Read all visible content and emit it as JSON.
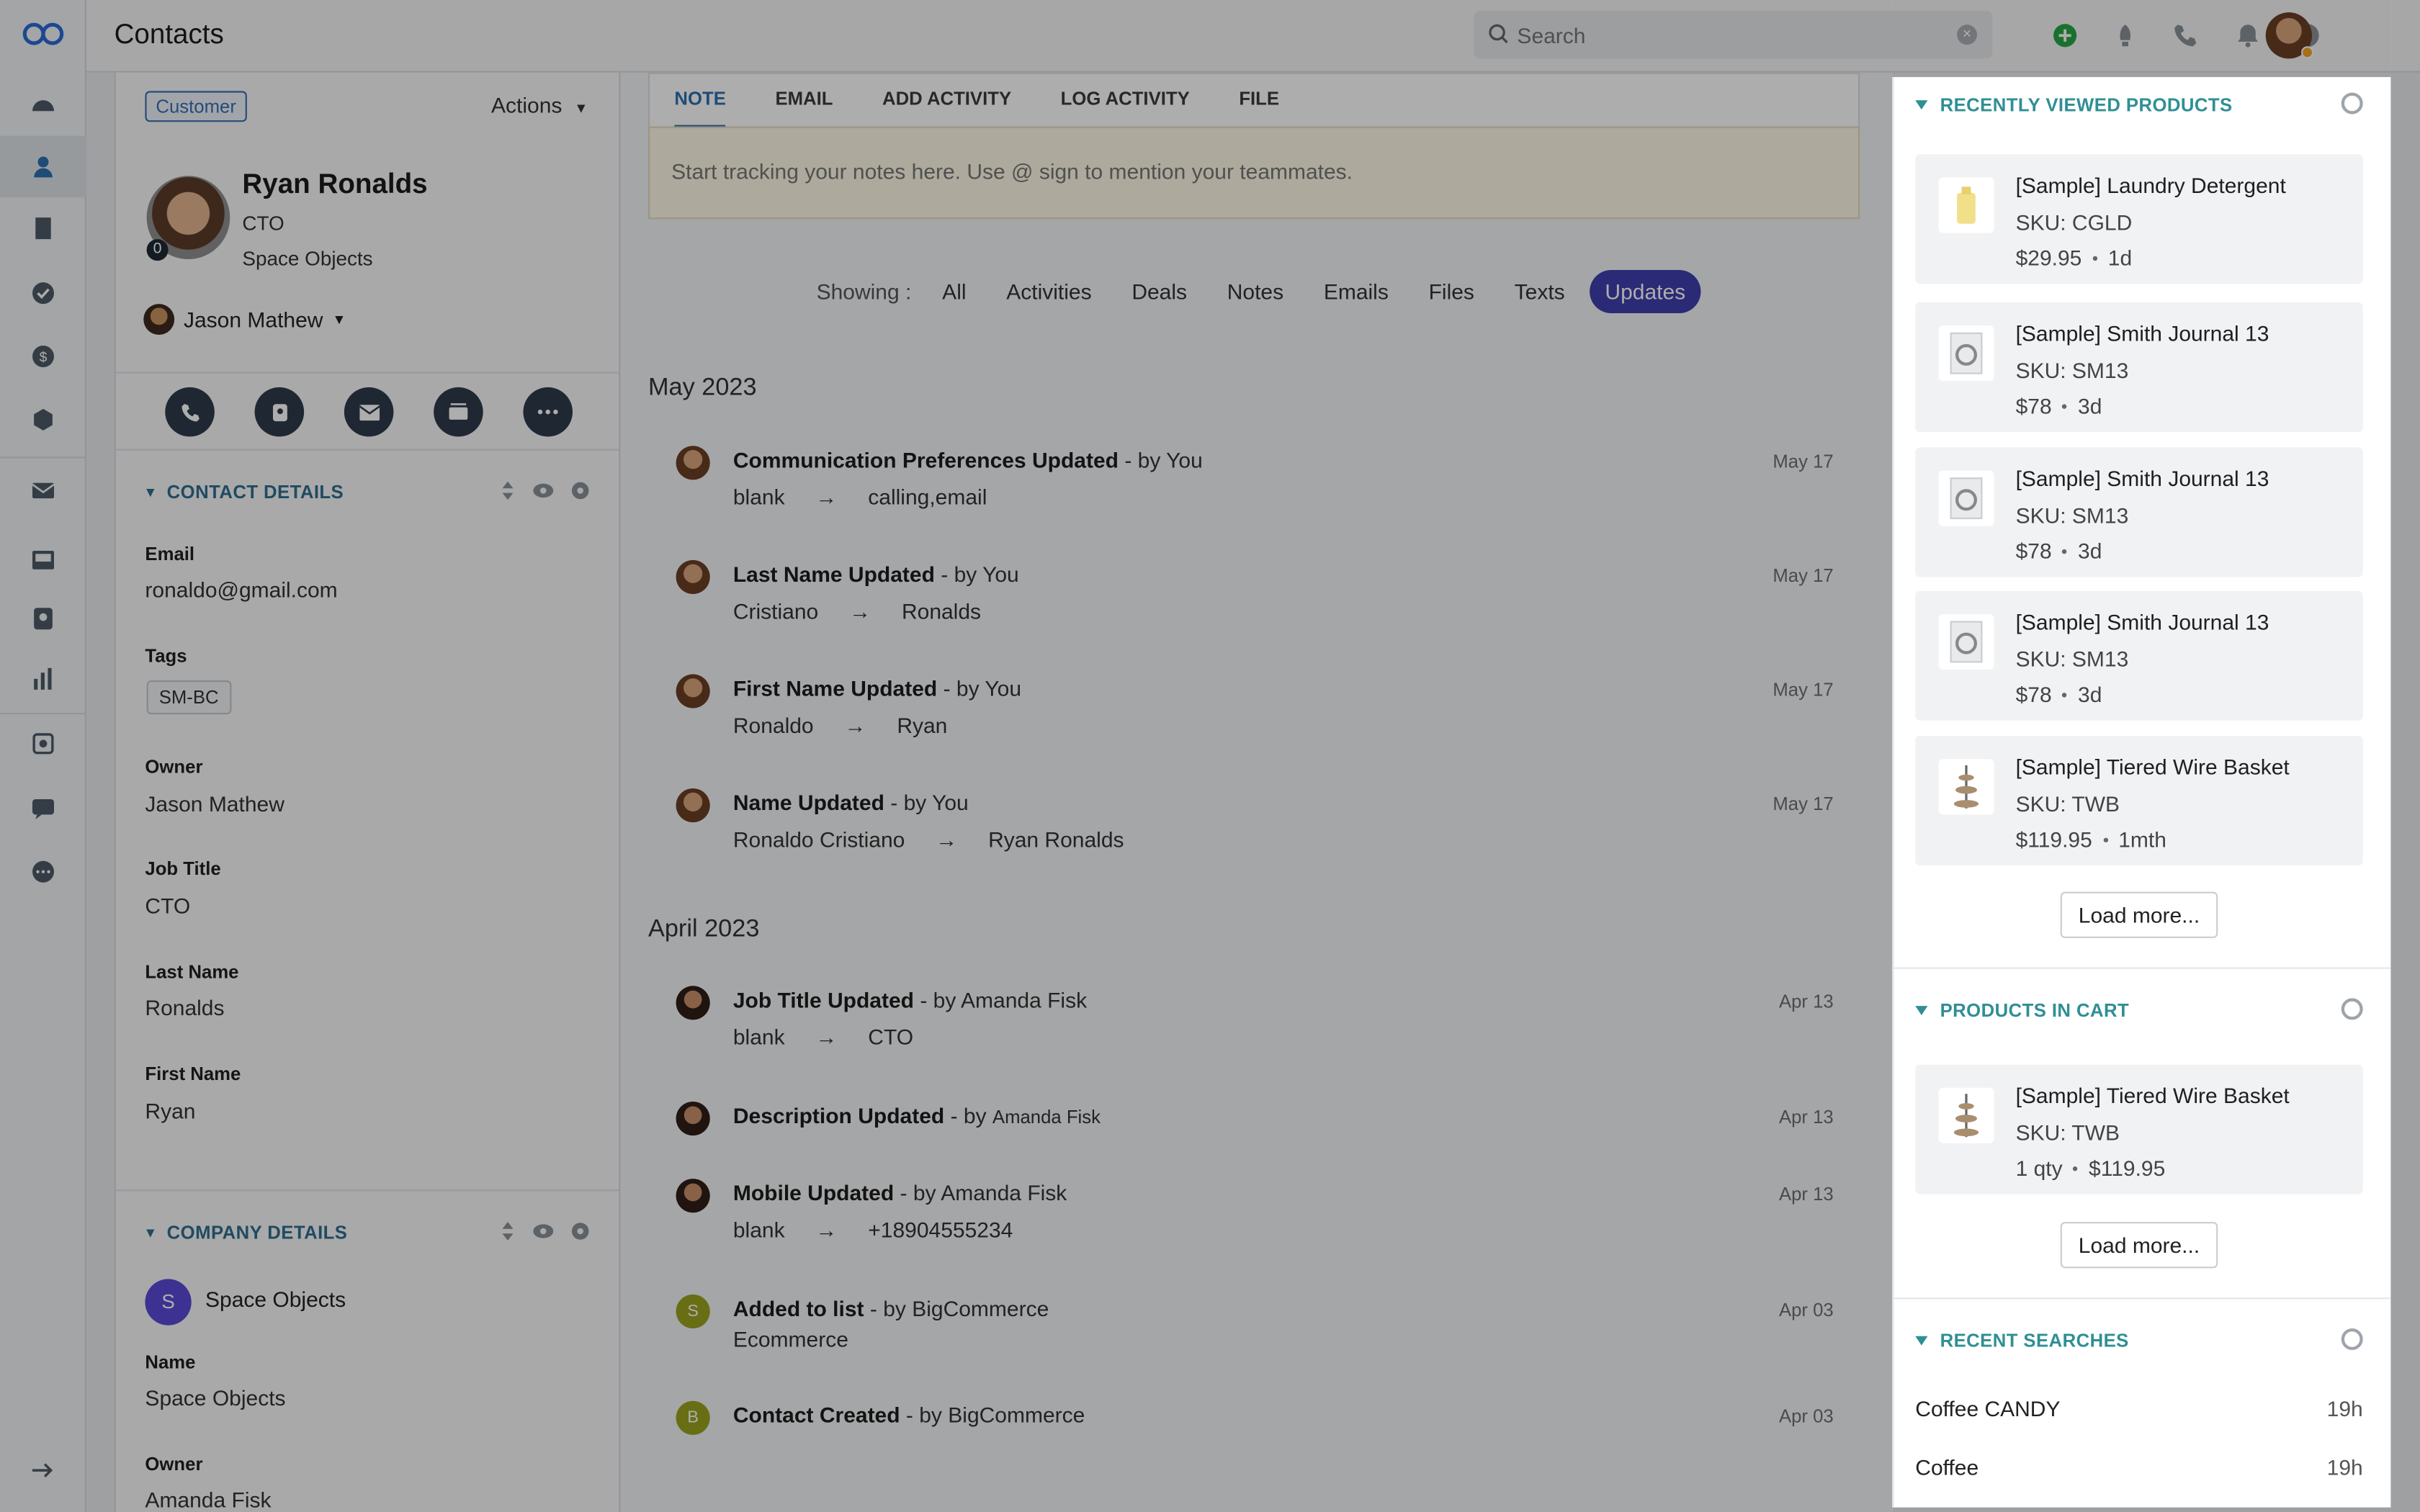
{
  "app": {
    "page_title": "Contacts"
  },
  "search": {
    "placeholder": "Search"
  },
  "profile": {
    "badge": "Customer",
    "actions_label": "Actions",
    "name": "Ryan Ronalds",
    "role": "CTO",
    "company": "Space Objects",
    "score": "0",
    "owner": "Jason Mathew"
  },
  "contact_details": {
    "header": "CONTACT DETAILS",
    "fields": [
      {
        "label": "Email",
        "value": "ronaldo@gmail.com"
      },
      {
        "label": "Tags",
        "value": "SM-BC"
      },
      {
        "label": "Owner",
        "value": "Jason Mathew"
      },
      {
        "label": "Job Title",
        "value": "CTO"
      },
      {
        "label": "Last Name",
        "value": "Ronalds"
      },
      {
        "label": "First Name",
        "value": "Ryan"
      }
    ]
  },
  "company_details": {
    "header": "COMPANY DETAILS",
    "avatar_letter": "S",
    "company_name": "Space Objects",
    "fields": [
      {
        "label": "Name",
        "value": "Space Objects"
      },
      {
        "label": "Owner",
        "value": "Amanda Fisk"
      }
    ]
  },
  "tabs": [
    "NOTE",
    "EMAIL",
    "ADD ACTIVITY",
    "LOG ACTIVITY",
    "FILE"
  ],
  "note_placeholder": "Start tracking your notes here. Use @ sign to mention your teammates.",
  "filters": {
    "label": "Showing :",
    "items": [
      "All",
      "Activities",
      "Deals",
      "Notes",
      "Emails",
      "Files",
      "Texts",
      "Updates"
    ],
    "active": "Updates"
  },
  "timeline": {
    "groups": [
      {
        "month": "May 2023",
        "events": [
          {
            "title": "Communication Preferences Updated",
            "by": "- by You",
            "from": "blank",
            "to": "calling,email",
            "date": "May 17"
          },
          {
            "title": "Last Name Updated",
            "by": "- by You",
            "from": "Cristiano",
            "to": "Ronalds",
            "date": "May 17"
          },
          {
            "title": "First Name Updated",
            "by": "- by You",
            "from": "Ronaldo",
            "to": "Ryan",
            "date": "May 17"
          },
          {
            "title": "Name Updated",
            "by": "- by You",
            "from": "Ronaldo Cristiano",
            "to": "Ryan Ronalds",
            "date": "May 17"
          }
        ]
      },
      {
        "month": "April 2023",
        "events": [
          {
            "title": "Job Title Updated",
            "by": "- by Amanda Fisk",
            "from": "blank",
            "to": "CTO",
            "date": "Apr 13"
          },
          {
            "title": "Description Updated",
            "by": "- by",
            "by_name": "Amanda Fisk",
            "date": "Apr 13"
          },
          {
            "title": "Mobile Updated",
            "by": "- by Amanda Fisk",
            "from": "blank",
            "to": "+18904555234",
            "date": "Apr 13"
          },
          {
            "title": "Added to list",
            "by": "- by BigCommerce",
            "sub": "Ecommerce",
            "date": "Apr 03",
            "avatar": "S"
          },
          {
            "title": "Contact Created",
            "by": "- by BigCommerce",
            "date": "Apr 03",
            "avatar": "B"
          }
        ]
      }
    ],
    "arrow": "→"
  },
  "recently_viewed": {
    "header": "RECENTLY VIEWED PRODUCTS",
    "items": [
      {
        "name": "[Sample] Laundry Detergent",
        "sku": "SKU: CGLD",
        "price": "$29.95",
        "age": "1d",
        "thumb": "bottle-icon"
      },
      {
        "name": "[Sample] Smith Journal 13",
        "sku": "SKU: SM13",
        "price": "$78",
        "age": "3d",
        "thumb": "journal-icon"
      },
      {
        "name": "[Sample] Smith Journal 13",
        "sku": "SKU: SM13",
        "price": "$78",
        "age": "3d",
        "thumb": "journal-icon"
      },
      {
        "name": "[Sample] Smith Journal 13",
        "sku": "SKU: SM13",
        "price": "$78",
        "age": "3d",
        "thumb": "journal-icon"
      },
      {
        "name": "[Sample] Tiered Wire Basket",
        "sku": "SKU: TWB",
        "price": "$119.95",
        "age": "1mth",
        "thumb": "basket-icon"
      }
    ],
    "load_more": "Load more..."
  },
  "cart": {
    "header": "PRODUCTS IN CART",
    "items": [
      {
        "name": "[Sample] Tiered Wire Basket",
        "sku": "SKU: TWB",
        "qty": "1 qty",
        "price": "$119.95"
      }
    ],
    "load_more": "Load more..."
  },
  "recent_searches": {
    "header": "RECENT SEARCHES",
    "items": [
      {
        "term": "Coffee CANDY",
        "age": "19h"
      },
      {
        "term": "Coffee",
        "age": "19h"
      }
    ]
  },
  "colors": {
    "accent": "#3f3eae",
    "section_teal": "#2f8f94",
    "link_blue": "#2f6fb0"
  }
}
